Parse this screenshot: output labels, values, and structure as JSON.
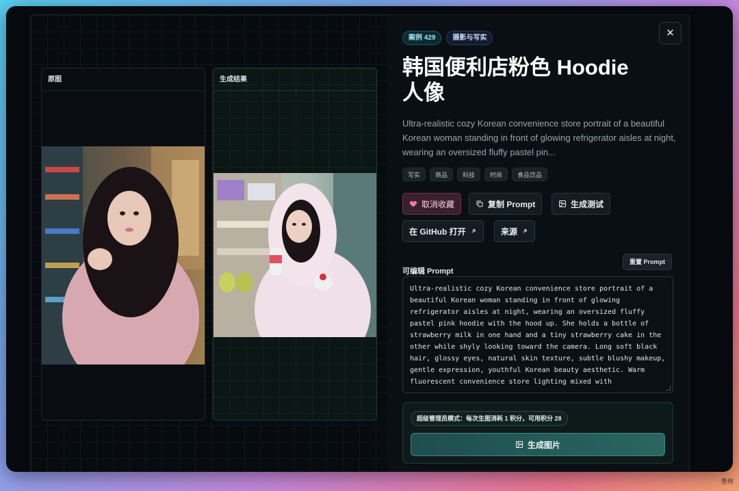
{
  "left": {
    "original_label": "原图",
    "result_label": "生成结果"
  },
  "detail": {
    "case_badge": "案例 429",
    "category_badge": "摄影与写实",
    "close_icon": "✕",
    "title": "韩国便利店粉色 Hoodie 人像",
    "description": "Ultra-realistic cozy Korean convenience store portrait of a beautiful Korean woman standing in front of glowing refrigerator aisles at night, wearing an oversized fluffy pastel pin...",
    "tags": [
      "写实",
      "商品",
      "科技",
      "时尚",
      "食品饮品"
    ],
    "buttons": {
      "unfavorite": "取消收藏",
      "copy_prompt": "复制 Prompt",
      "test_generate": "生成测试",
      "open_github": "在 GitHub 打开",
      "source": "来源"
    },
    "editable_label": "可编辑 Prompt",
    "reset_label": "重置 Prompt",
    "prompt_text": "Ultra-realistic cozy Korean convenience store portrait of a beautiful Korean woman standing in front of glowing refrigerator aisles at night, wearing an oversized fluffy pastel pink hoodie with the hood up. She holds a bottle of strawberry milk in one hand and a tiny strawberry cake in the other while shyly looking toward the camera. Long soft black hair, glossy eyes, natural skin texture, subtle blushy makeup, gentle expression, youthful Korean beauty aesthetic. Warm fluorescent convenience store lighting mixed with",
    "admin_note": "超级管理员模式：每次生图消耗 1 积分，可用积分 28",
    "generate_label": "生成图片"
  },
  "watermark": "苍何",
  "colors": {
    "accent": "#2a6660",
    "favorite": "#e06a9a"
  }
}
